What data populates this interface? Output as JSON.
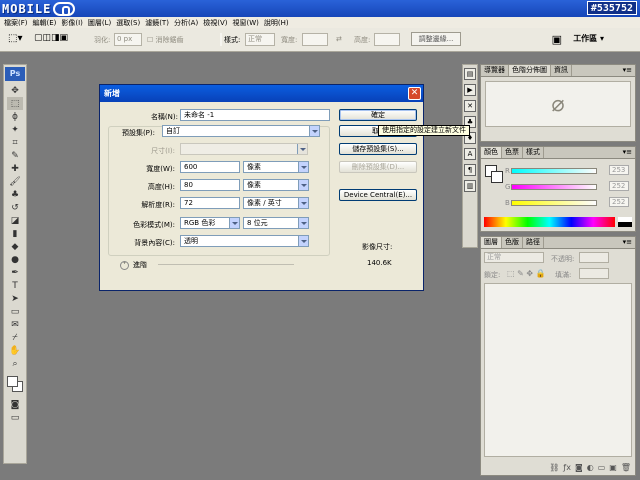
{
  "watermark": {
    "logo_text": "MOBILE",
    "counter": "#535752"
  },
  "menu": [
    "檔案(F)",
    "編輯(E)",
    "影像(I)",
    "圖層(L)",
    "選取(S)",
    "濾鏡(T)",
    "分析(A)",
    "檢視(V)",
    "視窗(W)",
    "說明(H)"
  ],
  "options": {
    "feather_label": "羽化:",
    "feather_value": "0 px",
    "antialias_label": "消除鋸齒",
    "style_label": "樣式:",
    "style_value": "正常",
    "width_label": "寬度:",
    "height_label": "高度:",
    "refine_button": "調整邊緣...",
    "workspace_label": "工作區 ▾"
  },
  "toolbox": {
    "ps_label": "Ps"
  },
  "panels": {
    "navigator_tabs": [
      "導覽器",
      "色階分佈圖",
      "資訊"
    ],
    "color_tabs": [
      "顏色",
      "色票",
      "樣式"
    ],
    "color_values": [
      "253",
      "252",
      "252"
    ],
    "color_channels": [
      "R",
      "G",
      "B"
    ],
    "layers_tabs": [
      "圖層",
      "色版",
      "路徑"
    ],
    "blend_mode": "正常",
    "opacity_label": "不透明:",
    "lock_label": "鎖定:",
    "fill_label": "填滿:"
  },
  "dialog": {
    "title": "新增",
    "name_label": "名稱(N):",
    "name_value": "未命名 -1",
    "preset_label": "預設集(P):",
    "preset_value": "自訂",
    "size_label": "尺寸(I):",
    "width_label": "寬度(W):",
    "width_value": "600",
    "width_unit": "像素",
    "height_label": "高度(H):",
    "height_value": "80",
    "height_unit": "像素",
    "resolution_label": "解析度(R):",
    "resolution_value": "72",
    "resolution_unit": "像素 / 英寸",
    "color_mode_label": "色彩模式(M):",
    "color_mode_value": "RGB 色彩",
    "bit_depth_value": "8 位元",
    "background_label": "背景內容(C):",
    "background_value": "透明",
    "advanced_label": "進階",
    "ok_button": "確定",
    "cancel_button": "取",
    "tooltip": "使用指定的設定建立新文件",
    "save_preset_button": "儲存預設集(S)...",
    "delete_preset_button": "刪除預設集(D)...",
    "device_central_button": "Device Central(E)...",
    "image_size_label": "影像尺寸:",
    "image_size_value": "140.6K"
  }
}
